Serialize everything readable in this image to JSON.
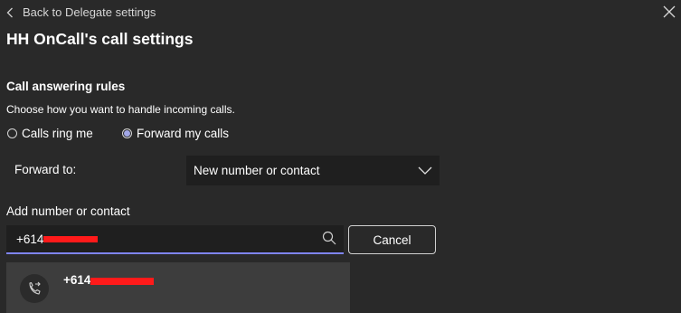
{
  "nav": {
    "back_label": "Back to Delegate settings",
    "back_icon": "chevron-left-icon",
    "close_icon": "close-icon"
  },
  "header": {
    "title": "HH OnCall's call settings"
  },
  "call_answering": {
    "title": "Call answering rules",
    "description": "Choose how you want to handle incoming calls.",
    "options": [
      {
        "label": "Calls ring me",
        "selected": false
      },
      {
        "label": "Forward my calls",
        "selected": true
      }
    ]
  },
  "forward": {
    "label": "Forward to:",
    "selected_value": "New number or contact",
    "chevron_icon": "chevron-down-icon"
  },
  "add_contact": {
    "label": "Add number or contact",
    "input_value": "+614",
    "search_icon": "search-icon",
    "cancel_label": "Cancel"
  },
  "suggestions": [
    {
      "number": "+614",
      "icon": "phone-forward-icon"
    }
  ],
  "colors": {
    "background": "#292929",
    "field_background": "#1f1f1f",
    "accent": "#7f85f5",
    "radio_selected": "#a2a7e6",
    "suggestion_background": "#3d3d3d",
    "redaction": "#ff1a1a"
  }
}
